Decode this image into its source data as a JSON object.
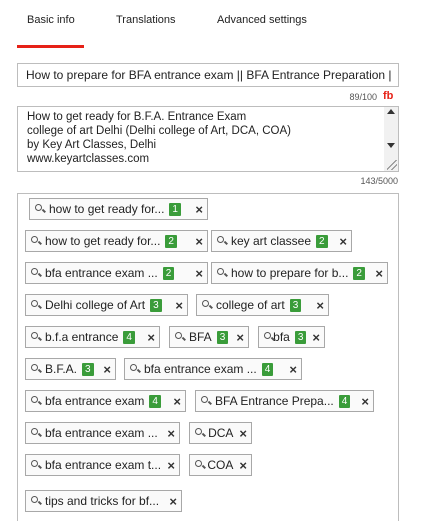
{
  "tabs": [
    {
      "label": "Basic info",
      "active": true
    },
    {
      "label": "Translations"
    },
    {
      "label": "Advanced settings"
    }
  ],
  "title": {
    "value": "How to prepare for BFA entrance exam || BFA Entrance Preparation |",
    "count": "89/100",
    "icon": "fb-icon",
    "icon_text": "fb"
  },
  "description": {
    "lines": [
      "How to get ready for B.F.A. Entrance Exam",
      "college of art Delhi (Delhi college of Art, DCA, COA)",
      "by Key Art Classes, Delhi",
      "www.keyartclasses.com"
    ],
    "count": "143/5000"
  },
  "tags": [
    {
      "text": "how to get ready for...",
      "badge": "1"
    },
    {
      "text": "how to get ready for...",
      "badge": "2"
    },
    {
      "text": "key art classee",
      "badge": "2"
    },
    {
      "text": "bfa entrance exam ...",
      "badge": "2"
    },
    {
      "text": "how to prepare for b...",
      "badge": "2"
    },
    {
      "text": "Delhi college of Art",
      "badge": "3"
    },
    {
      "text": "college of art",
      "badge": "3"
    },
    {
      "text": "b.f.a entrance",
      "badge": "4"
    },
    {
      "text": "BFA",
      "badge": "3"
    },
    {
      "text": "bfa",
      "badge": "3"
    },
    {
      "text": "B.F.A.",
      "badge": "3"
    },
    {
      "text": "bfa entrance exam ...",
      "badge": "4"
    },
    {
      "text": "bfa entrance exam",
      "badge": "4"
    },
    {
      "text": "BFA Entrance Prepa...",
      "badge": "4"
    },
    {
      "text": "bfa entrance exam ...",
      "badge": null
    },
    {
      "text": "DCA",
      "badge": null
    },
    {
      "text": "bfa entrance exam t...",
      "badge": null
    },
    {
      "text": "COA",
      "badge": null
    },
    {
      "text": "tips and tricks for bf...",
      "badge": null
    }
  ],
  "colors": {
    "accent": "#e62117",
    "badge": "#3a9c3a",
    "border": "#bdbdbd"
  }
}
